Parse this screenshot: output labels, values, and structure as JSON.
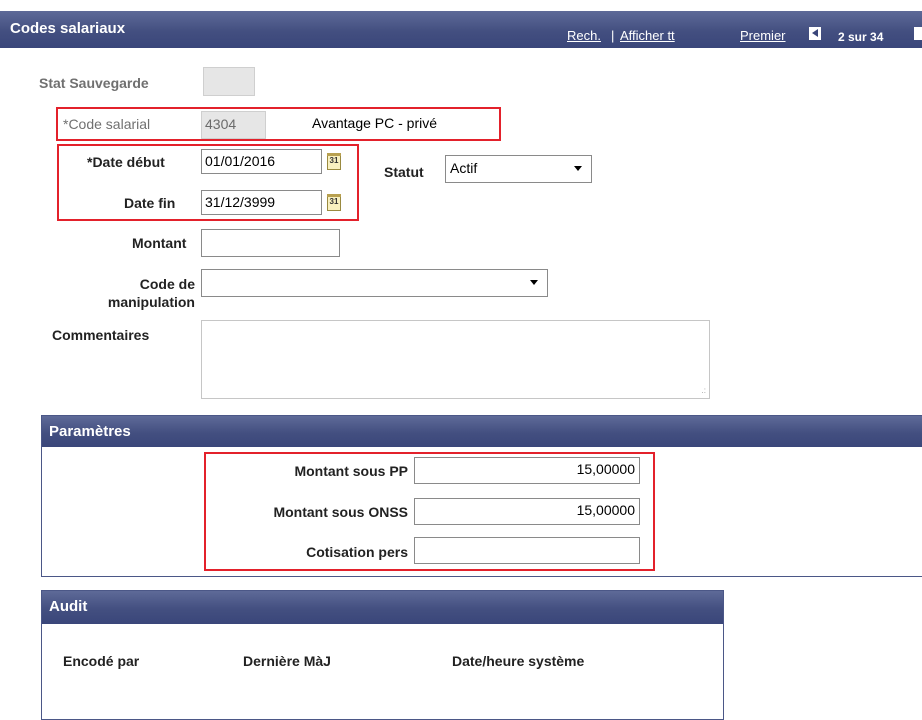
{
  "header": {
    "title": "Codes salariaux",
    "search_link": "Rech.",
    "separator": "|",
    "show_all_link": "Afficher tt",
    "first_link": "Premier",
    "position": "2 sur 34"
  },
  "form": {
    "save_status": {
      "label": "Stat Sauvegarde",
      "value": ""
    },
    "pay_code": {
      "label": "*Code salarial",
      "value": "4304",
      "description": "Avantage PC - privé"
    },
    "start_date": {
      "label": "*Date début",
      "value": "01/01/2016"
    },
    "end_date": {
      "label": "Date fin",
      "value": "31/12/3999"
    },
    "status": {
      "label": "Statut",
      "value": "Actif"
    },
    "amount": {
      "label": "Montant",
      "value": ""
    },
    "handling_code": {
      "label_line1": "Code de",
      "label_line2": "manipulation",
      "value": ""
    },
    "comments": {
      "label": "Commentaires",
      "value": ""
    },
    "calendar_glyph": "31"
  },
  "parameters": {
    "title": "Paramètres",
    "amount_pp": {
      "label": "Montant sous PP",
      "value": "15,00000"
    },
    "amount_onss": {
      "label": "Montant sous ONSS",
      "value": "15,00000"
    },
    "personal_contribution": {
      "label": "Cotisation pers",
      "value": ""
    }
  },
  "audit": {
    "title": "Audit",
    "columns": [
      "Encodé par",
      "Dernière MàJ",
      "Date/heure système"
    ]
  },
  "colors": {
    "header_bg": "#434f80",
    "highlight_border": "#e3212b",
    "readonly_bg": "#e6e6e6"
  },
  "icons": {
    "calendar": "calendar-icon",
    "dropdown": "chevron-down-icon",
    "prev": "arrow-left-icon"
  }
}
